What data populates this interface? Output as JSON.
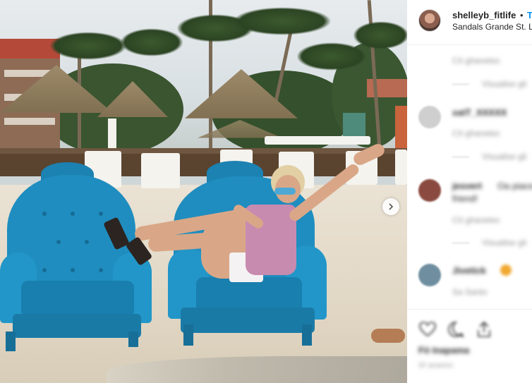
{
  "post": {
    "username": "shelleyb_fitlife",
    "separator": "•",
    "follow_label": "T",
    "location": "Sandals Grande St. Lu"
  },
  "comments": [
    {
      "text": "Cô ghanetec",
      "sub": "Visualise gli"
    },
    {
      "user": "xatT_XXXXX",
      "meta": "Cô ghanetec",
      "sub": "Visualise gli"
    },
    {
      "user": "jesvert",
      "text": "Oa piace",
      "text2": "friend!",
      "meta": "Cô ghanetec",
      "sub": "Visualise gli"
    },
    {
      "user": "Jivetick",
      "meta": "Sa Santo"
    }
  ],
  "likes_text": "Fö Inapama",
  "date_text": "Sf anamin",
  "icons": [
    "heart-icon",
    "comment-icon",
    "share-icon",
    "next-arrow-icon"
  ],
  "colors": {
    "follow": "#0095f6",
    "chair": "#1f8dbf"
  }
}
